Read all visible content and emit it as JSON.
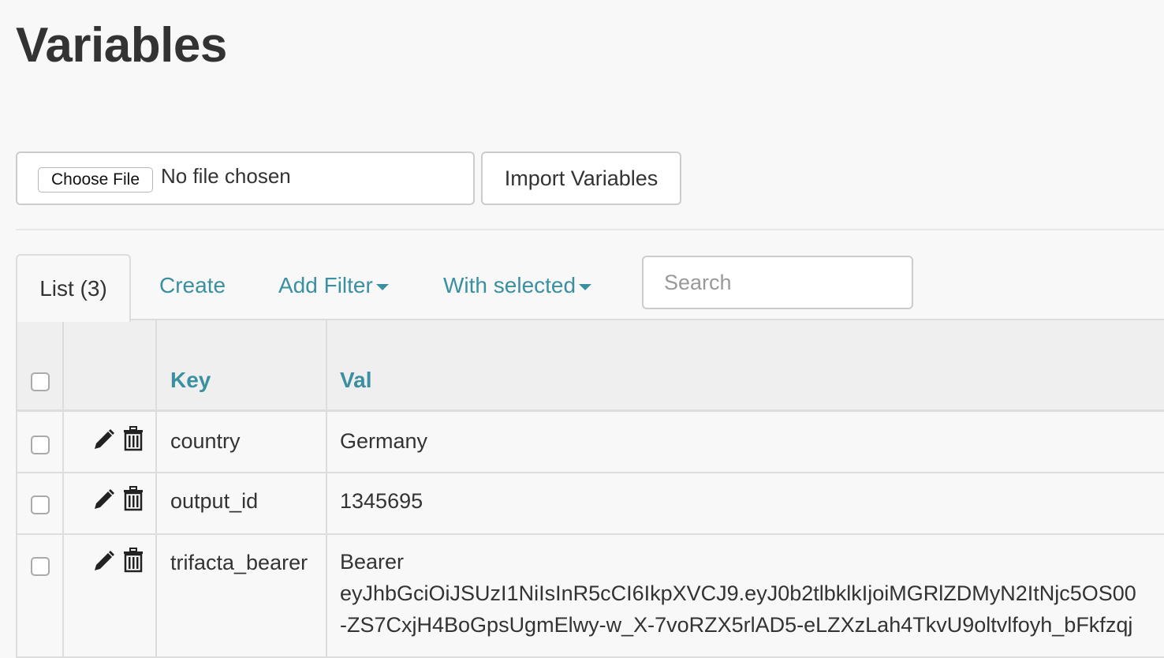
{
  "page": {
    "title": "Variables"
  },
  "import": {
    "choose_file_label": "Choose File",
    "file_status": "No file chosen",
    "import_button_label": "Import Variables"
  },
  "tabs": {
    "list_label": "List (3)",
    "create_label": "Create",
    "add_filter_label": "Add Filter",
    "with_selected_label": "With selected"
  },
  "search": {
    "placeholder": "Search"
  },
  "table": {
    "columns": {
      "key": "Key",
      "val": "Val"
    },
    "rows": [
      {
        "key": "country",
        "val": "Germany"
      },
      {
        "key": "output_id",
        "val": "1345695"
      },
      {
        "key": "trifacta_bearer",
        "val_line1": "Bearer",
        "val_line2": "eyJhbGciOiJSUzI1NiIsInR5cCI6IkpXVCJ9.eyJ0b2tlbklkIjoiMGRlZDMyN2ItNjc5OS00",
        "val_line3": "-ZS7CxjH4BoGpsUgmElwy-w_X-7voRZX5rlAD5-eLZXzLah4TkvU9oltvlfoyh_bFkfzqj"
      }
    ]
  },
  "colors": {
    "link": "#3a8fa0",
    "text": "#333333",
    "background": "#f8f8f8"
  }
}
